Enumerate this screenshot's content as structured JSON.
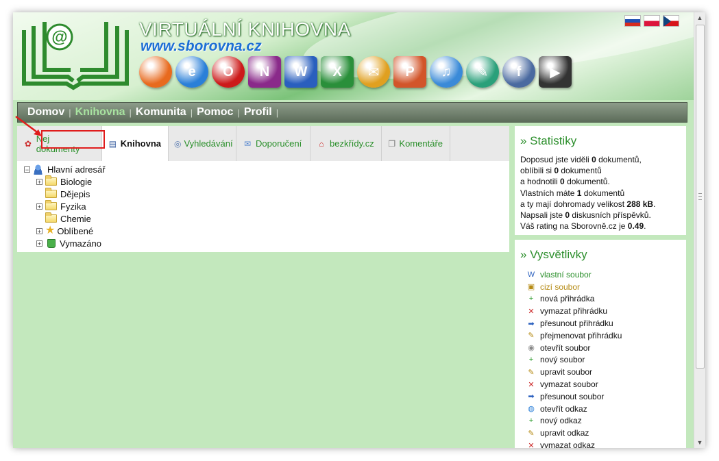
{
  "header": {
    "title": "VIRTUÁLNÍ KNIHOVNA",
    "url": "www.sborovna.cz",
    "flags": [
      "flag-slovak",
      "flag-polish",
      "flag-czech"
    ],
    "app_icons": [
      {
        "name": "firefox-icon",
        "glyph": "",
        "color": "#e86a1e"
      },
      {
        "name": "internet-explorer-icon",
        "glyph": "e",
        "color": "#2a7fd8"
      },
      {
        "name": "opera-icon",
        "glyph": "O",
        "color": "#cc1a1a"
      },
      {
        "name": "onenote-icon",
        "glyph": "N",
        "color": "#8a2a8a"
      },
      {
        "name": "word-icon",
        "glyph": "W",
        "color": "#2a5fbe"
      },
      {
        "name": "excel-icon",
        "glyph": "X",
        "color": "#2a8f3a"
      },
      {
        "name": "outlook-icon",
        "glyph": "✉",
        "color": "#e0a020"
      },
      {
        "name": "powerpoint-icon",
        "glyph": "P",
        "color": "#d2552a"
      },
      {
        "name": "itunes-icon",
        "glyph": "♫",
        "color": "#3a8ad8"
      },
      {
        "name": "quill-icon",
        "glyph": "✎",
        "color": "#2aa07a"
      },
      {
        "name": "flash-icon",
        "glyph": "f",
        "color": "#4a6aa0"
      },
      {
        "name": "avi-icon",
        "glyph": "▶",
        "color": "#333333"
      }
    ]
  },
  "nav": {
    "items": [
      "Domov",
      "Knihovna",
      "Komunita",
      "Pomoc",
      "Profil"
    ],
    "active": "Knihovna"
  },
  "tabs": [
    {
      "label": "Nej dokumenty",
      "icon": "award-icon",
      "glyph": "✿",
      "color": "#cc2a2a"
    },
    {
      "label": "Knihovna",
      "icon": "library-icon",
      "glyph": "▤",
      "color": "#3a5fa0"
    },
    {
      "label": "Vyhledávání",
      "icon": "search-icon",
      "glyph": "🔍",
      "color": "#5a7ab0"
    },
    {
      "label": "Doporučení",
      "icon": "envelope-icon",
      "glyph": "✉",
      "color": "#5a8ad0"
    },
    {
      "label": "bezkřídy.cz",
      "icon": "home-icon",
      "glyph": "⌂",
      "color": "#cc2a2a"
    },
    {
      "label": "Komentáře",
      "icon": "comments-icon",
      "glyph": "❐",
      "color": "#777777"
    }
  ],
  "tree": {
    "root": "Hlavní adresář",
    "items": [
      {
        "label": "Biologie",
        "expandable": true
      },
      {
        "label": "Dějepis",
        "expandable": false
      },
      {
        "label": "Fyzika",
        "expandable": true
      },
      {
        "label": "Chemie",
        "expandable": false
      },
      {
        "label": "Oblíbené",
        "expandable": true
      },
      {
        "label": "Vymazáno",
        "expandable": true
      }
    ]
  },
  "stats": {
    "title": "» Statistiky",
    "l1a": "Doposud jste viděli ",
    "l1b": "0",
    "l1c": " dokumentů,",
    "l2a": "oblíbili si ",
    "l2b": "0",
    "l2c": " dokumentů",
    "l3a": "a hodnotili ",
    "l3b": "0",
    "l3c": " dokumentů.",
    "l4a": "Vlastních máte ",
    "l4b": "1",
    "l4c": " dokumentů",
    "l5a": "a ty mají dohromady velikost ",
    "l5b": "288 kB",
    "l5c": ".",
    "l6a": "Napsali jste ",
    "l6b": "0",
    "l6c": " diskusních příspěvků.",
    "l7a": "Váš rating na Sborovně.cz je ",
    "l7b": "0.49",
    "l7c": "."
  },
  "legend": {
    "title": "» Vysvětlivky",
    "items": [
      {
        "label": "vlastní soubor",
        "icon": "own-file-icon",
        "glyph": "W",
        "color": "#2a5fbe",
        "style": "own"
      },
      {
        "label": "cizí soubor",
        "icon": "foreign-file-icon",
        "glyph": "▣",
        "color": "#b58a13",
        "style": "foreign"
      },
      {
        "label": "nová přihrádka",
        "icon": "new-folder-icon",
        "glyph": "+",
        "color": "#2a9a2a",
        "style": ""
      },
      {
        "label": "vymazat přihrádku",
        "icon": "delete-folder-icon",
        "glyph": "✕",
        "color": "#cc2a2a",
        "style": ""
      },
      {
        "label": "přesunout přihrádku",
        "icon": "move-folder-icon",
        "glyph": "➡",
        "color": "#2a5fbe",
        "style": ""
      },
      {
        "label": "přejmenovat přihrádku",
        "icon": "rename-folder-icon",
        "glyph": "✎",
        "color": "#b58a13",
        "style": ""
      },
      {
        "label": "otevřít soubor",
        "icon": "open-file-icon",
        "glyph": "◉",
        "color": "#888888",
        "style": ""
      },
      {
        "label": "nový soubor",
        "icon": "new-file-icon",
        "glyph": "+",
        "color": "#2a9a2a",
        "style": ""
      },
      {
        "label": "upravit soubor",
        "icon": "edit-file-icon",
        "glyph": "✎",
        "color": "#b58a13",
        "style": ""
      },
      {
        "label": "vymazat soubor",
        "icon": "delete-file-icon",
        "glyph": "✕",
        "color": "#cc2a2a",
        "style": ""
      },
      {
        "label": "přesunout soubor",
        "icon": "move-file-icon",
        "glyph": "➡",
        "color": "#2a5fbe",
        "style": ""
      },
      {
        "label": "otevřít odkaz",
        "icon": "open-link-icon",
        "glyph": "◍",
        "color": "#2a7fd8",
        "style": ""
      },
      {
        "label": "nový odkaz",
        "icon": "new-link-icon",
        "glyph": "+",
        "color": "#2a9a2a",
        "style": ""
      },
      {
        "label": "upravit odkaz",
        "icon": "edit-link-icon",
        "glyph": "✎",
        "color": "#b58a13",
        "style": ""
      },
      {
        "label": "vymazat odkaz",
        "icon": "delete-link-icon",
        "glyph": "✕",
        "color": "#cc2a2a",
        "style": ""
      }
    ]
  }
}
